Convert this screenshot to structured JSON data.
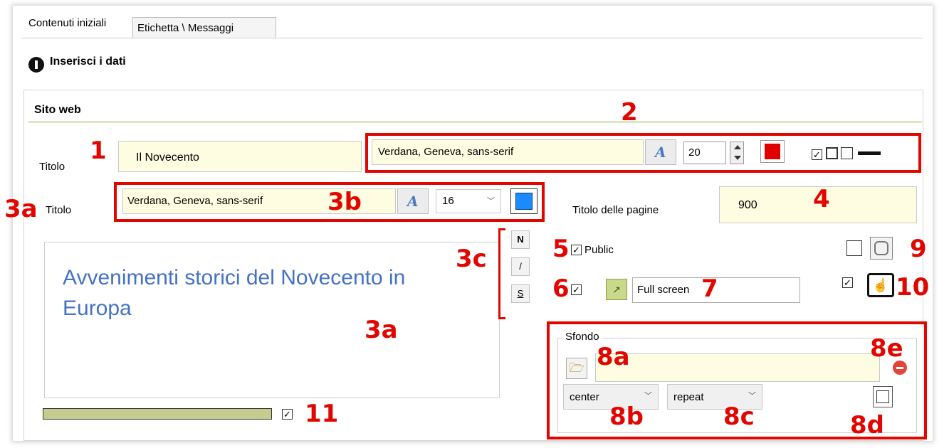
{
  "tabs": [
    {
      "label": "Contenuti iniziali",
      "active": true
    },
    {
      "label": "Etichetta \\ Messaggi",
      "active": false
    }
  ],
  "step": {
    "title": "Inserisci i dati"
  },
  "group": {
    "title": "Sito web"
  },
  "row1": {
    "label": "Titolo",
    "title_value": "Il Novecento",
    "font_value": "Verdana, Geneva, sans-serif",
    "size_value": "20",
    "color": "#e00000"
  },
  "row2": {
    "label": "Titolo",
    "font_value": "Verdana, Geneva, sans-serif",
    "size_value": "16",
    "color": "#1a8cff"
  },
  "pages": {
    "label": "Titolo delle pagine",
    "value": "900"
  },
  "style_buttons": {
    "bold": "N",
    "italic": "/",
    "underline": "S"
  },
  "preview": {
    "text": "Avvenimenti storici del Novecento in Europa"
  },
  "options": {
    "public_label": "Public",
    "fullscreen_value": "Full screen"
  },
  "background": {
    "title": "Sfondo",
    "position": "center",
    "repeat": "repeat"
  },
  "annotations": {
    "a1": "1",
    "a2": "2",
    "a3a_left": "3a",
    "a3b": "3b",
    "a3c": "3c",
    "a3a_preview": "3a",
    "a4": "4",
    "a5": "5",
    "a6": "6",
    "a7": "7",
    "a8a": "8a",
    "a8b": "8b",
    "a8c": "8c",
    "a8d": "8d",
    "a8e": "8e",
    "a9": "9",
    "a10": "10",
    "a11": "11"
  },
  "colors": {
    "annotation": "#e10600",
    "accent_bar": "#c5cc8e",
    "field_bg": "#fffde1"
  }
}
